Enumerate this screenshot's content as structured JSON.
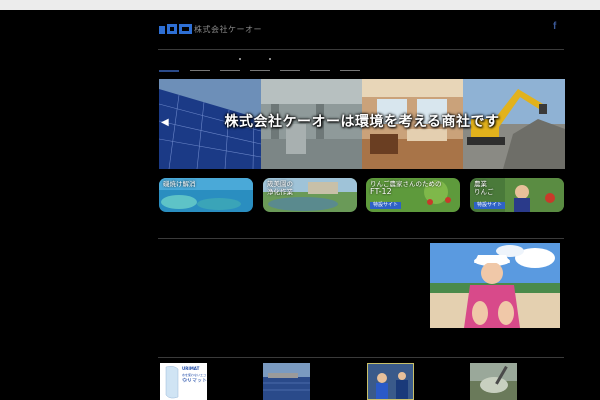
{
  "header": {
    "logo_text": "株式会社ケーオー",
    "social_label": "f"
  },
  "nav": {
    "items": [
      "",
      "",
      "",
      "",
      "",
      "",
      ""
    ],
    "active_index": 0
  },
  "hero": {
    "title": "株式会社ケーオーは環境を考える商社です"
  },
  "banners": [
    {
      "label": "磯焼け解消",
      "badge": ""
    },
    {
      "label_line1": "筬美園の",
      "label_line2": "浄化作業",
      "badge": ""
    },
    {
      "label_line1": "りんご農家さんのための",
      "label_line2": "FT-12",
      "badge": "特設サイト"
    },
    {
      "label_line1": "農業",
      "label_line2": "りんご",
      "badge": "特設サイト"
    }
  ],
  "products": {
    "urimat_label": "URIMAT",
    "urimat_sub": "水を使わないエコトイレ",
    "urimat_name": "ウリマット"
  },
  "colors": {
    "background": "#000000",
    "divider": "#3a3a3a",
    "accent": "#2a4a8a",
    "badge": "#2e62c6",
    "facebook": "#3b5998"
  }
}
